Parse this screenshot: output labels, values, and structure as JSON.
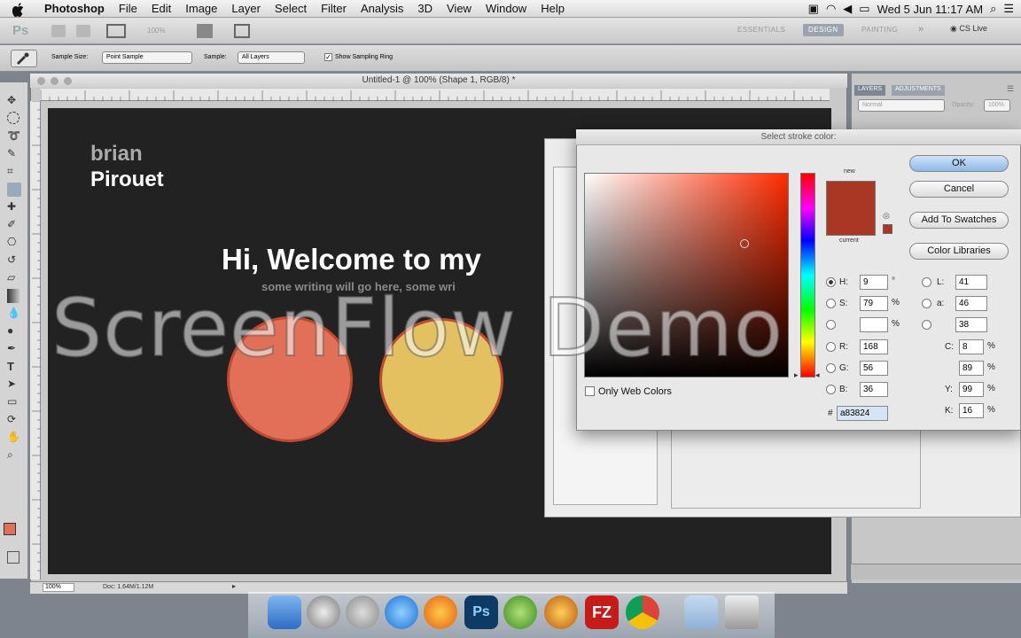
{
  "menubar": {
    "app_name": "Photoshop",
    "items": [
      "File",
      "Edit",
      "Image",
      "Layer",
      "Select",
      "Filter",
      "Analysis",
      "3D",
      "View",
      "Window",
      "Help"
    ],
    "clock": "Wed 5 Jun  11:17 AM"
  },
  "appbar": {
    "logo": "Ps",
    "zoom": "100%",
    "workspaces": [
      "ESSENTIALS",
      "DESIGN",
      "PAINTING"
    ],
    "cs_live": "CS Live"
  },
  "options": {
    "sample_size_label": "Sample Size:",
    "sample_size_value": "Point Sample",
    "sample_label": "Sample:",
    "sample_value": "All Layers",
    "show_ring_label": "Show Sampling Ring"
  },
  "document": {
    "title": "Untitled-1 @ 100% (Shape 1, RGB/8) *",
    "zoom": "100%",
    "doc_info": "Doc: 1.64M/1.12M"
  },
  "canvas": {
    "brand_line1": "brian",
    "brand_line2": "Pirouet",
    "headline": "Hi, Welcome to my",
    "subline": "some writing will go here,  some wri",
    "circle1_color": "#e07058",
    "circle2_color": "#e3c060"
  },
  "layers_panel": {
    "tabs": [
      "LAYERS",
      "ADJUSTMENTS"
    ],
    "blend_mode": "Normal",
    "opacity_label": "Opacity:",
    "opacity_value": "100%"
  },
  "picker": {
    "title": "Select stroke color:",
    "new_label": "new",
    "current_label": "current",
    "new_color": "#a83824",
    "current_color": "#a83824",
    "buttons": {
      "ok": "OK",
      "cancel": "Cancel",
      "add_swatches": "Add To Swatches",
      "libraries": "Color Libraries"
    },
    "only_web_colors": "Only Web Colors",
    "fields": {
      "H": "9",
      "S": "79",
      "B_hsb": "",
      "R": "168",
      "G": "56",
      "B": "36",
      "L": "41",
      "a": "46",
      "b": "38",
      "C": "8",
      "M": "89",
      "Y": "99",
      "K": "16",
      "hex": "a83824"
    },
    "units": {
      "deg": "°",
      "pct": "%"
    }
  },
  "tools": {
    "foreground_color": "#e07058",
    "background_color": "#ffffff"
  },
  "watermark": "ScreenFlow Demo"
}
